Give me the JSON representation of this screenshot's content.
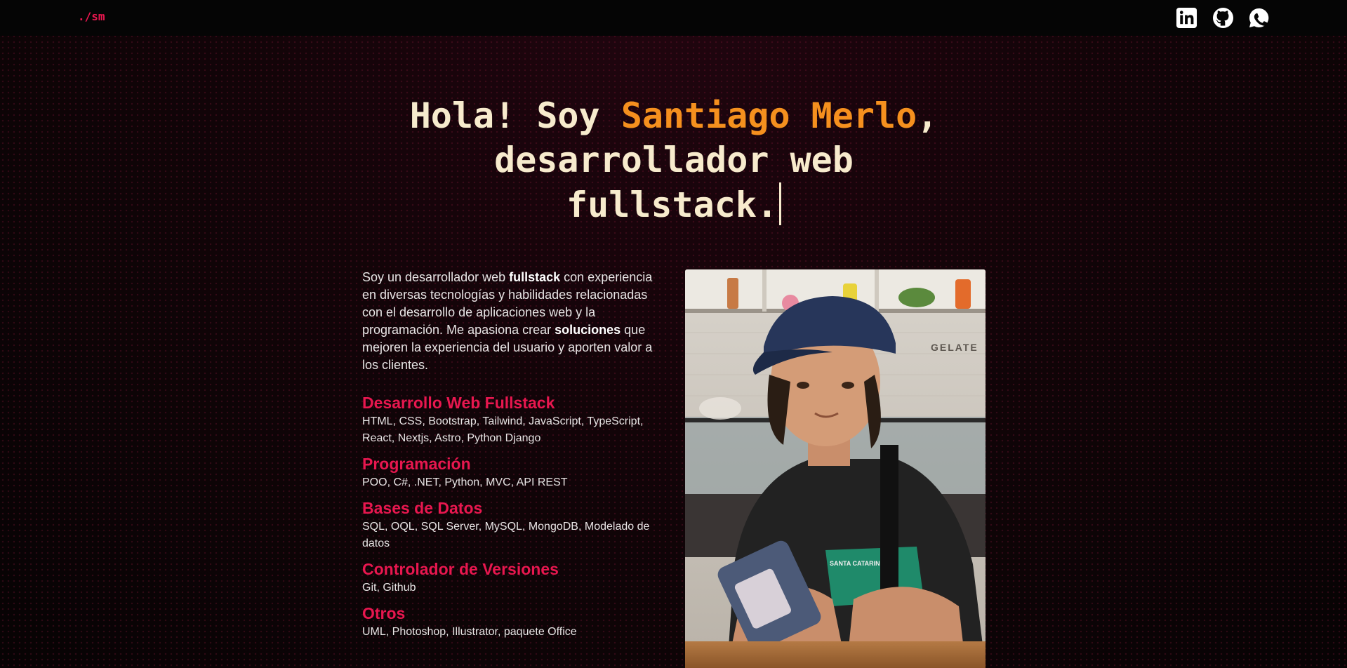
{
  "nav": {
    "logo": "./sm",
    "social": [
      {
        "icon": "linkedin-icon"
      },
      {
        "icon": "github-icon"
      },
      {
        "icon": "whatsapp-icon"
      }
    ]
  },
  "hero": {
    "greeting": "Hola! Soy ",
    "name": "Santiago Merlo",
    "comma": ",",
    "line2": "desarrollador web",
    "line3": "fullstack."
  },
  "about": {
    "p1": "Soy un desarrollador web ",
    "b1": "fullstack",
    "p2": " con experiencia en diversas tecnologías y habilidades relacionadas con el desarrollo de aplicaciones web y la programación. Me apasiona crear ",
    "b2": "soluciones",
    "p3": " que mejoren la experiencia del usuario y aporten valor a los clientes."
  },
  "skills": [
    {
      "title": "Desarrollo Web Fullstack",
      "items": "HTML, CSS, Bootstrap, Tailwind, JavaScript, TypeScript, React, Nextjs, Astro, Python Django"
    },
    {
      "title": "Programación",
      "items": "POO, C#, .NET, Python, MVC, API REST"
    },
    {
      "title": "Bases de Datos",
      "items": "SQL, OQL, SQL Server, MySQL, MongoDB, Modelado de datos"
    },
    {
      "title": "Controlador de Versiones",
      "items": "Git, Github"
    },
    {
      "title": "Otros",
      "items": "UML, Photoshop, Illustrator, paquete Office"
    }
  ],
  "photo": {
    "shop_sign": "GELATE",
    "shirt_text": "SANTA CATARINA"
  },
  "colors": {
    "accent": "#e8174f",
    "name": "#f5901e",
    "hero_text": "#f7ebcd",
    "navbar": "#050505"
  }
}
